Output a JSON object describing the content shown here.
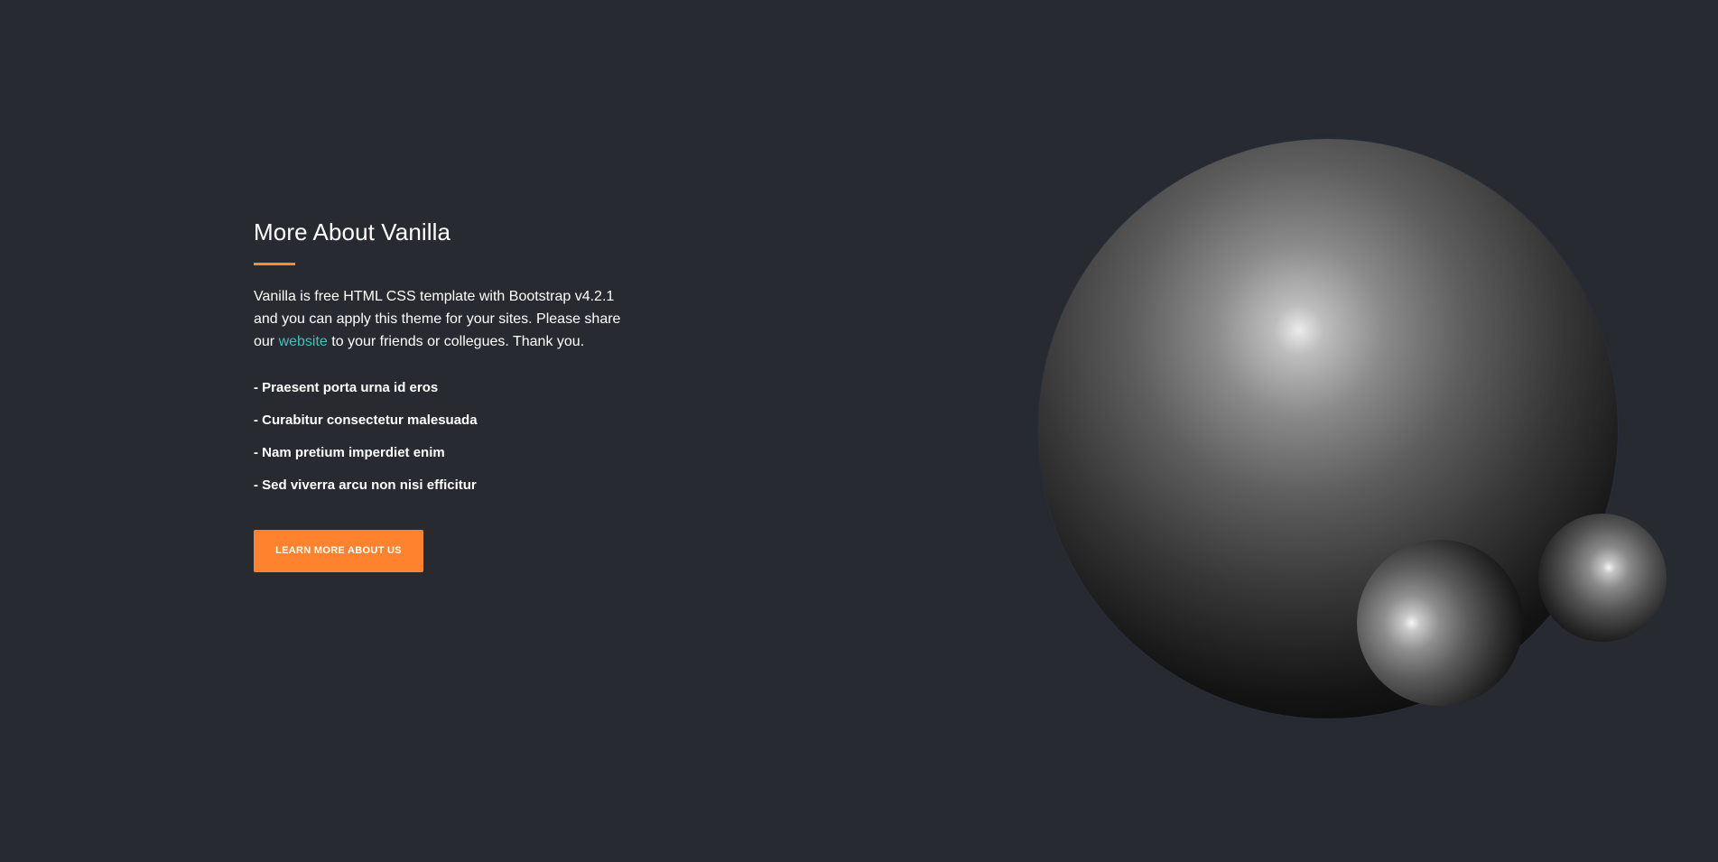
{
  "about": {
    "title": "More About Vanilla",
    "text_before_link": "Vanilla is free HTML CSS template with Bootstrap v4.2.1 and you can apply this theme for your sites. Please share our ",
    "link_text": "website",
    "text_after_link": " to your friends or collegues. Thank you.",
    "features": [
      "- Praesent porta urna id eros",
      "- Curabitur consectetur malesuada",
      "- Nam pretium imperdiet enim",
      "- Sed viverra arcu non nisi efficitur"
    ],
    "button_label": "LEARN MORE ABOUT US"
  },
  "colors": {
    "background": "#272a30",
    "accent": "#ff822f",
    "link": "#3ec1c1",
    "text": "#ffffff"
  }
}
